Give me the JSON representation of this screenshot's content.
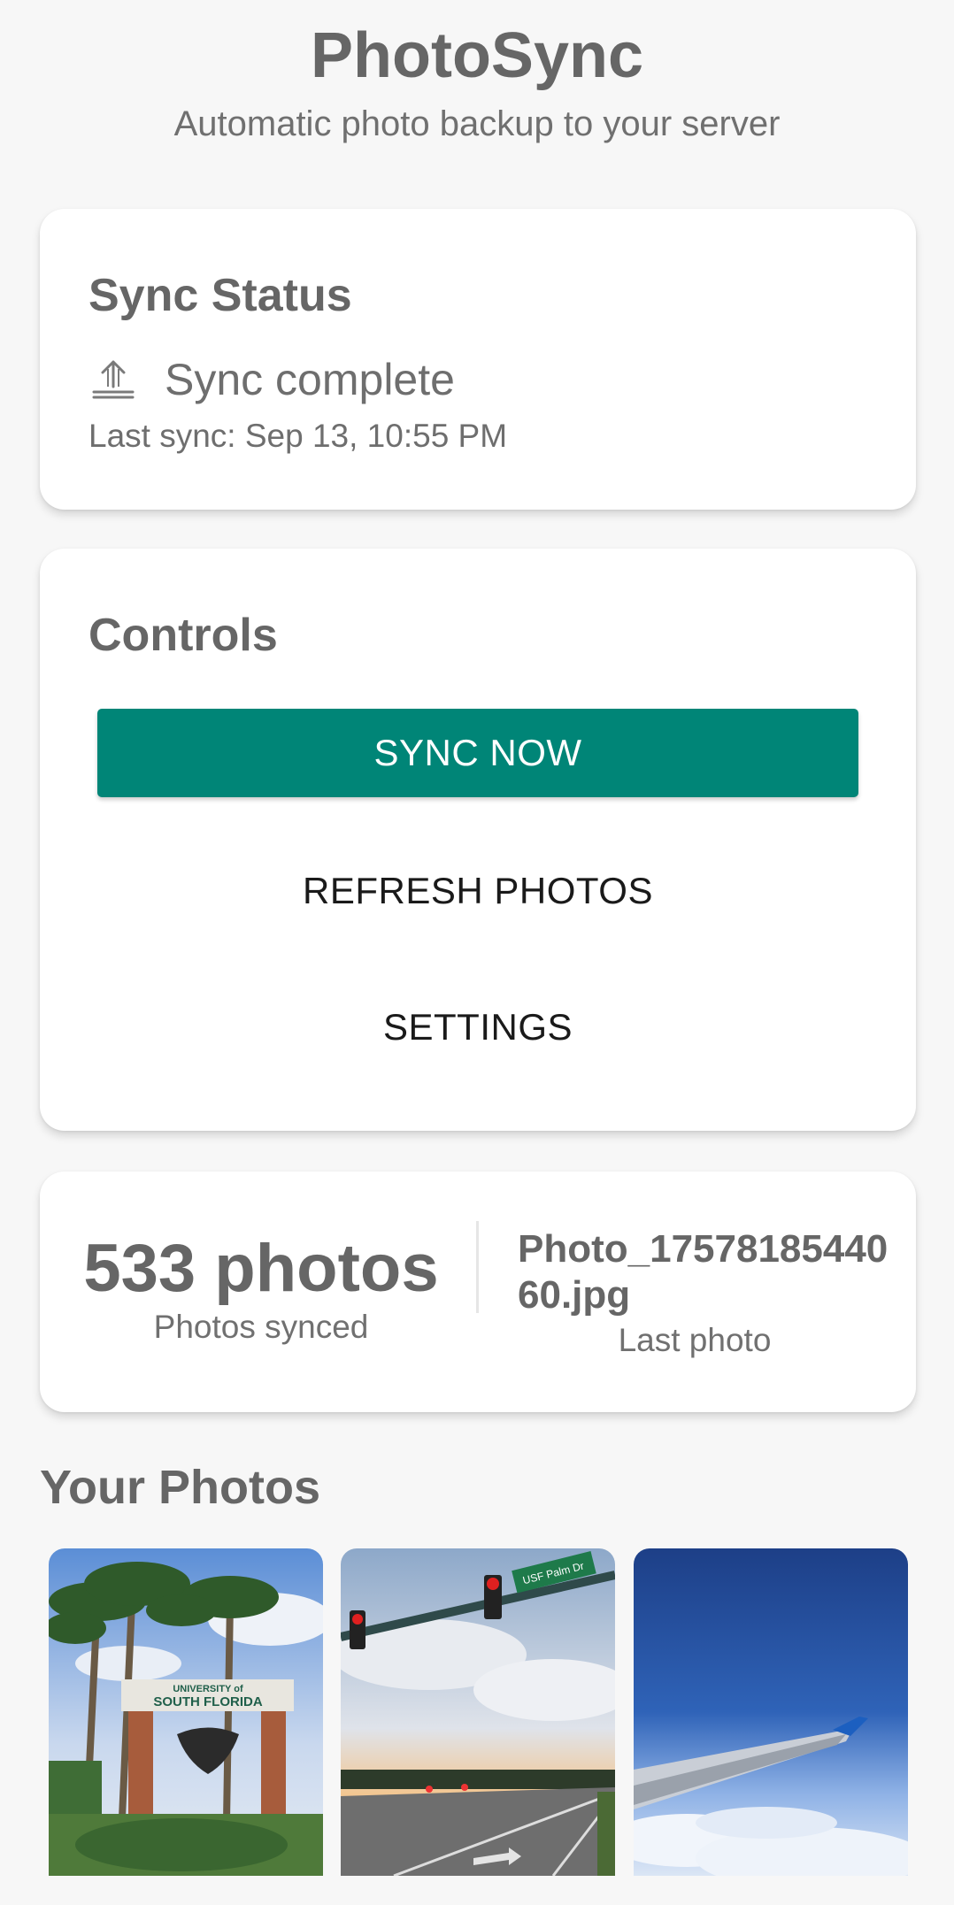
{
  "header": {
    "title": "PhotoSync",
    "subtitle": "Automatic photo backup to your server"
  },
  "status_card": {
    "title": "Sync Status",
    "icon": "upload-icon",
    "status": "Sync complete",
    "last_sync": "Last sync: Sep 13, 10:55 PM"
  },
  "controls": {
    "title": "Controls",
    "sync_now_label": "SYNC NOW",
    "refresh_label": "REFRESH PHOTOS",
    "settings_label": "SETTINGS",
    "accent_color": "#008577"
  },
  "stats": {
    "count": "533 photos",
    "count_label": "Photos synced",
    "last_photo": "Photo_1757818544060.jpg",
    "last_photo_label": "Last photo"
  },
  "photos_section": {
    "title": "Your Photos",
    "photos": [
      {
        "sign_line1": "UNIVERSITY of",
        "sign_line2": "SOUTH FLORIDA"
      },
      {
        "street_sign": "USF Palm Dr"
      },
      {}
    ]
  }
}
